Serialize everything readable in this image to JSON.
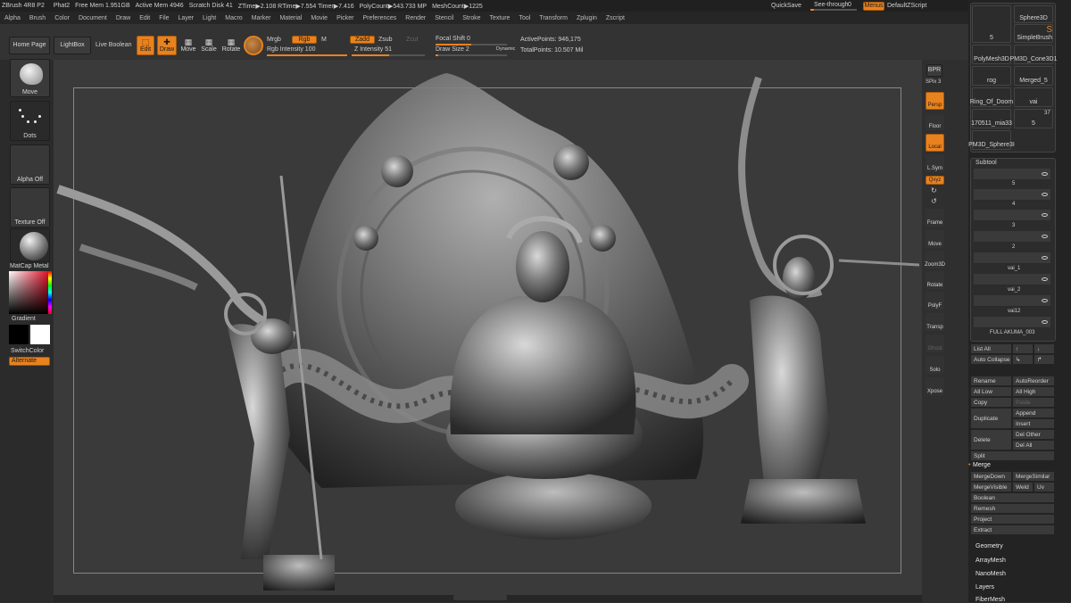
{
  "titlebar": {
    "app": "ZBrush 4R8 P2",
    "doc": "Phat2",
    "stats": [
      "Free Mem 1.951GB",
      "Active Mem 4946",
      "Scratch Disk 41",
      "ZTime▶2.108 RTime▶7.554 Timer▶7.416",
      "PolyCount▶543.733 MP",
      "MeshCount▶1225"
    ],
    "quicksave": "QuickSave",
    "see_through_label": "See-through",
    "see_through_value": "0",
    "menus": "Menus",
    "script": "DefaultZScript"
  },
  "menubar": [
    "Alpha",
    "Brush",
    "Color",
    "Document",
    "Draw",
    "Edit",
    "File",
    "Layer",
    "Light",
    "Macro",
    "Marker",
    "Material",
    "Movie",
    "Picker",
    "Preferences",
    "Render",
    "Stencil",
    "Stroke",
    "Texture",
    "Tool",
    "Transform",
    "Zplugin",
    "Zscript"
  ],
  "topshelf": {
    "home_page": "Home Page",
    "lightbox": "LightBox",
    "live_boolean": "Live Boolean",
    "edit": "Edit",
    "draw": "Draw",
    "move": "Move",
    "scale": "Scale",
    "rotate": "Rotate",
    "mrgb": "Mrgb",
    "rgb": "Rgb",
    "m": "M",
    "zadd": "Zadd",
    "zsub": "Zsub",
    "zcut": "Zcut",
    "rgb_intensity": "Rgb Intensity 100",
    "z_intensity": "Z Intensity 51",
    "focal_shift": "Focal Shift 0",
    "draw_size": "Draw Size 2",
    "dynamic": "Dynamic",
    "active_points": "ActivePoints: 946,175",
    "total_points": "TotalPoints: 10.507 Mil"
  },
  "leftshelf": {
    "move_brush": "Move",
    "dots": "Dots",
    "alpha_off": "Alpha Off",
    "texture_off": "Texture Off",
    "matcap": "MatCap Metal",
    "gradient": "Gradient",
    "switch_color": "SwitchColor",
    "alternate": "Alternate"
  },
  "rightshelf": {
    "bpr": "BPR",
    "spix": "SPix 3",
    "persp": "Persp",
    "floor": "Floor",
    "local": "Local",
    "lsym": "L.Sym",
    "xyz": "Qxyz",
    "frame": "Frame",
    "move": "Move",
    "zoom3d": "Zoom3D",
    "rotate": "Rotate",
    "polyf": "PolyF",
    "transp": "Transp",
    "ghost": "Ghost",
    "solo": "Solo",
    "xpose": "Xpose"
  },
  "tool_thumbs": [
    "5",
    "Sphere3D",
    "SimpleBrush",
    "PolyMesh3D",
    "PM3D_Cone3D1",
    "rog",
    "Merged_5",
    "Ring_Of_Doom",
    "vai",
    "170511_mia33",
    "5",
    "PM3D_Sphere3I"
  ],
  "tool_count": "37",
  "subtool": {
    "title": "Subtool",
    "items": [
      "5",
      "4",
      "3",
      "2",
      "vai_1",
      "vai_2",
      "vai12",
      "FULL AKUMA_003"
    ]
  },
  "subtool_buttons": {
    "list_all": "List All",
    "auto_collapse": "Auto Collapse",
    "rename": "Rename",
    "auto_reorder": "AutoReorder",
    "all_low": "All Low",
    "all_high": "All High",
    "copy": "Copy",
    "paste": "Paste",
    "duplicate": "Duplicate",
    "append": "Append",
    "insert": "Insert",
    "delete": "Delete",
    "del_other": "Del Other",
    "del_all": "Del All",
    "split": "Split",
    "merge": "Merge",
    "merge_down": "MergeDown",
    "merge_similar": "MergeSimilar",
    "merge_visible": "MergeVisible",
    "weld": "Weld",
    "uv": "Uv",
    "boolean": "Boolean",
    "remesh": "Remesh",
    "project": "Project",
    "extract": "Extract"
  },
  "tool_menu": [
    "Geometry",
    "ArrayMesh",
    "NanoMesh",
    "Layers",
    "FiberMesh"
  ]
}
